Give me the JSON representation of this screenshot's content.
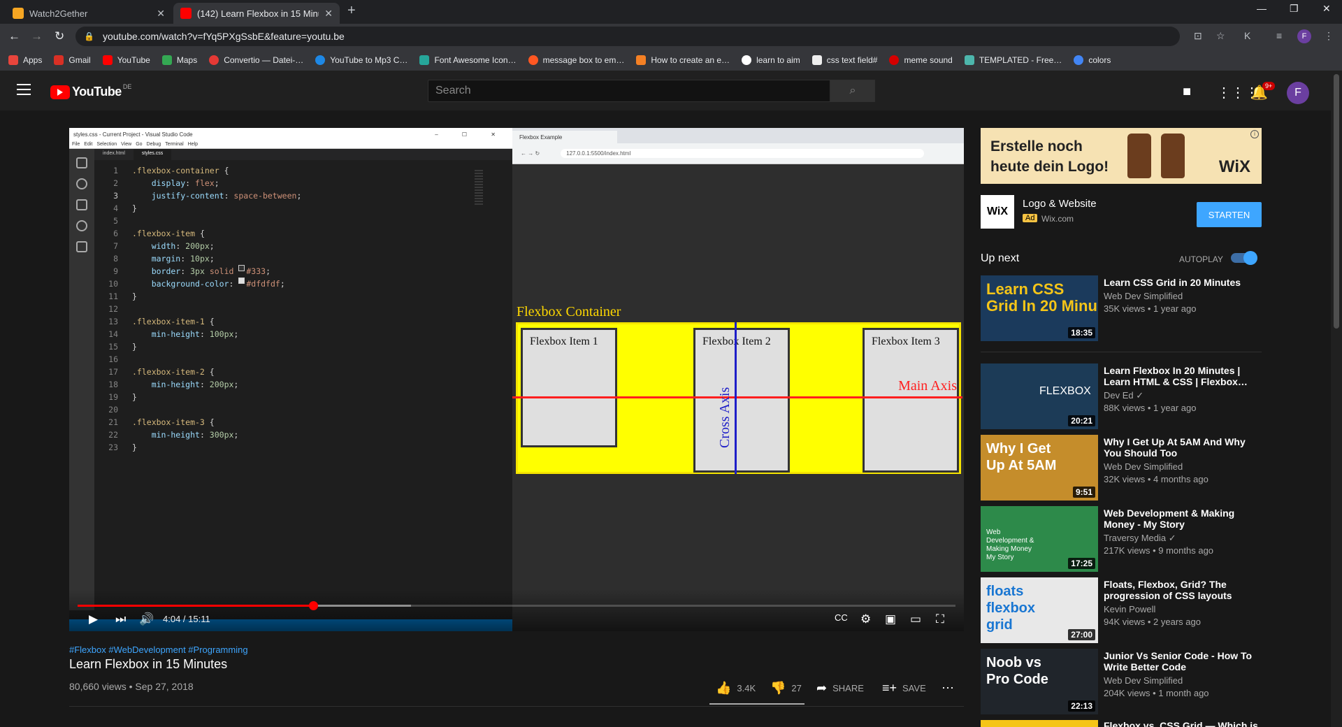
{
  "browser": {
    "tabs": [
      {
        "title": "Watch2Gether",
        "active": false,
        "icon": "w2g-icon"
      },
      {
        "title": "(142) Learn Flexbox in 15 Minute",
        "active": true,
        "icon": "youtube-icon"
      }
    ],
    "url": "youtube.com/watch?v=fYq5PXgSsbE&feature=youtu.be",
    "profile_initial": "F",
    "profile_k": "K",
    "bookmarks": [
      "Apps",
      "Gmail",
      "YouTube",
      "Maps",
      "Convertio — Datei-…",
      "YouTube to Mp3 C…",
      "Font Awesome Icon…",
      "message box to em…",
      "How to create an e…",
      "learn to aim",
      "css text field#",
      "meme sound",
      "TEMPLATED - Free…",
      "colors"
    ]
  },
  "youtube": {
    "logo_word": "YouTube",
    "country": "DE",
    "search_placeholder": "Search",
    "notif_count": "9+",
    "avatar_initial": "F"
  },
  "video": {
    "vscode_title": "styles.css - Current Project - Visual Studio Code",
    "vscode_menu": [
      "File",
      "Edit",
      "Selection",
      "View",
      "Go",
      "Debug",
      "Terminal",
      "Help"
    ],
    "vscode_tabs": [
      "index.html",
      "styles.css"
    ],
    "code_lines": [
      ".flexbox-container {",
      "    display: flex;",
      "    justify-content: space-between;",
      "}",
      "",
      ".flexbox-item {",
      "    width: 200px;",
      "    margin: 10px;",
      "    border: 3px solid #333;",
      "    background-color: #dfdfdf;",
      "}",
      "",
      ".flexbox-item-1 {",
      "    min-height: 100px;",
      "}",
      "",
      ".flexbox-item-2 {",
      "    min-height: 200px;",
      "}",
      "",
      ".flexbox-item-3 {",
      "    min-height: 300px;",
      "}"
    ],
    "browser_tab": "Flexbox Example",
    "browser_url": "127.0.0.1:5500/index.html",
    "container_label": "Flexbox Container",
    "items": [
      "Flexbox Item   1",
      "Flexbox Item   2",
      "Flexbox Item   3"
    ],
    "main_axis_label": "Main Axis",
    "cross_axis_label": "Cross Axis",
    "time": "4:04 / 15:11",
    "played_fraction": 0.268,
    "buffered_fraction": 0.38,
    "hashtags": "#Flexbox #WebDevelopment #Programming",
    "title": "Learn Flexbox in 15 Minutes",
    "meta": "80,660 views • Sep 27, 2018",
    "likes": "3.4K",
    "dislikes": "27",
    "share": "SHARE",
    "save": "SAVE"
  },
  "sidebar": {
    "ad_line1": "Erstelle noch",
    "ad_line2": "heute dein Logo!",
    "ad_brand": "WiX",
    "ad_title": "Logo & Website",
    "ad_badge": "Ad",
    "ad_domain": "Wix.com",
    "ad_cta": "STARTEN",
    "up_next": "Up next",
    "autoplay": "AUTOPLAY",
    "recs": [
      {
        "title": "Learn CSS Grid in 20 Minutes",
        "channel": "Web Dev Simplified",
        "meta": "35K views • 1 year ago",
        "duration": "18:35",
        "thumb_text": "Learn CSS Grid In 20 Minu",
        "thumb_color": "#1b3a5c"
      },
      {
        "title": "Learn Flexbox In 20 Minutes | Learn HTML & CSS | Flexbox…",
        "channel": "Dev Ed ✓",
        "meta": "88K views • 1 year ago",
        "duration": "20:21",
        "thumb_text": "FLEXBOX",
        "thumb_color": "#1c3b57"
      },
      {
        "title": "Why I Get Up At 5AM And Why You Should Too",
        "channel": "Web Dev Simplified",
        "meta": "32K views • 4 months ago",
        "duration": "9:51",
        "thumb_text": "Why I Get Up At 5AM",
        "thumb_color": "#c58d2b"
      },
      {
        "title": "Web Development & Making Money - My Story",
        "channel": "Traversy Media ✓",
        "meta": "217K views • 9 months ago",
        "duration": "17:25",
        "thumb_text": "Web Development & Making Money My Story",
        "thumb_color": "#2d8a4a"
      },
      {
        "title": "Floats, Flexbox, Grid? The progression of CSS layouts",
        "channel": "Kevin Powell",
        "meta": "94K views • 2 years ago",
        "duration": "27:00",
        "thumb_text": "floats flexbox grid",
        "thumb_color": "#e8e8e8"
      },
      {
        "title": "Junior Vs Senior Code - How To Write Better Code",
        "channel": "Web Dev Simplified",
        "meta": "204K views • 1 month ago",
        "duration": "22:13",
        "thumb_text": "Noob vs Pro Code",
        "thumb_color": "#20252b"
      }
    ],
    "partial_title": "Flexbox vs. CSS Grid — Which is"
  }
}
